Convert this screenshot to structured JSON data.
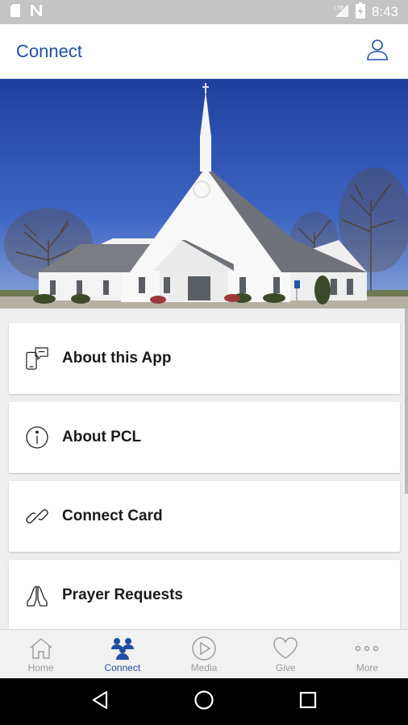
{
  "status_bar": {
    "time": "8:43",
    "icons": [
      "sd-card-icon",
      "notification-n-icon",
      "signal-lte-icon",
      "battery-icon"
    ]
  },
  "app_bar": {
    "title": "Connect",
    "profile_icon": "user-profile-icon"
  },
  "hero": {
    "image": "white church building with steeple under blue sky"
  },
  "menu": {
    "items": [
      {
        "label": "About this App",
        "icon": "mobile-chat-icon"
      },
      {
        "label": "About PCL",
        "icon": "info-icon"
      },
      {
        "label": "Connect Card",
        "icon": "link-icon"
      },
      {
        "label": "Prayer Requests",
        "icon": "praying-hands-icon"
      }
    ]
  },
  "bottom_nav": {
    "items": [
      {
        "label": "Home",
        "icon": "home-icon",
        "active": false
      },
      {
        "label": "Connect",
        "icon": "people-icon",
        "active": true
      },
      {
        "label": "Media",
        "icon": "play-circle-icon",
        "active": false
      },
      {
        "label": "Give",
        "icon": "heart-icon",
        "active": false
      },
      {
        "label": "More",
        "icon": "more-dots-icon",
        "active": false
      }
    ]
  },
  "system_nav": [
    "back-icon",
    "home-circle-icon",
    "recents-square-icon"
  ],
  "colors": {
    "accent": "#1f4fa0",
    "status_bar": "#c4c4c4",
    "inactive_nav": "#9a9a9a"
  }
}
